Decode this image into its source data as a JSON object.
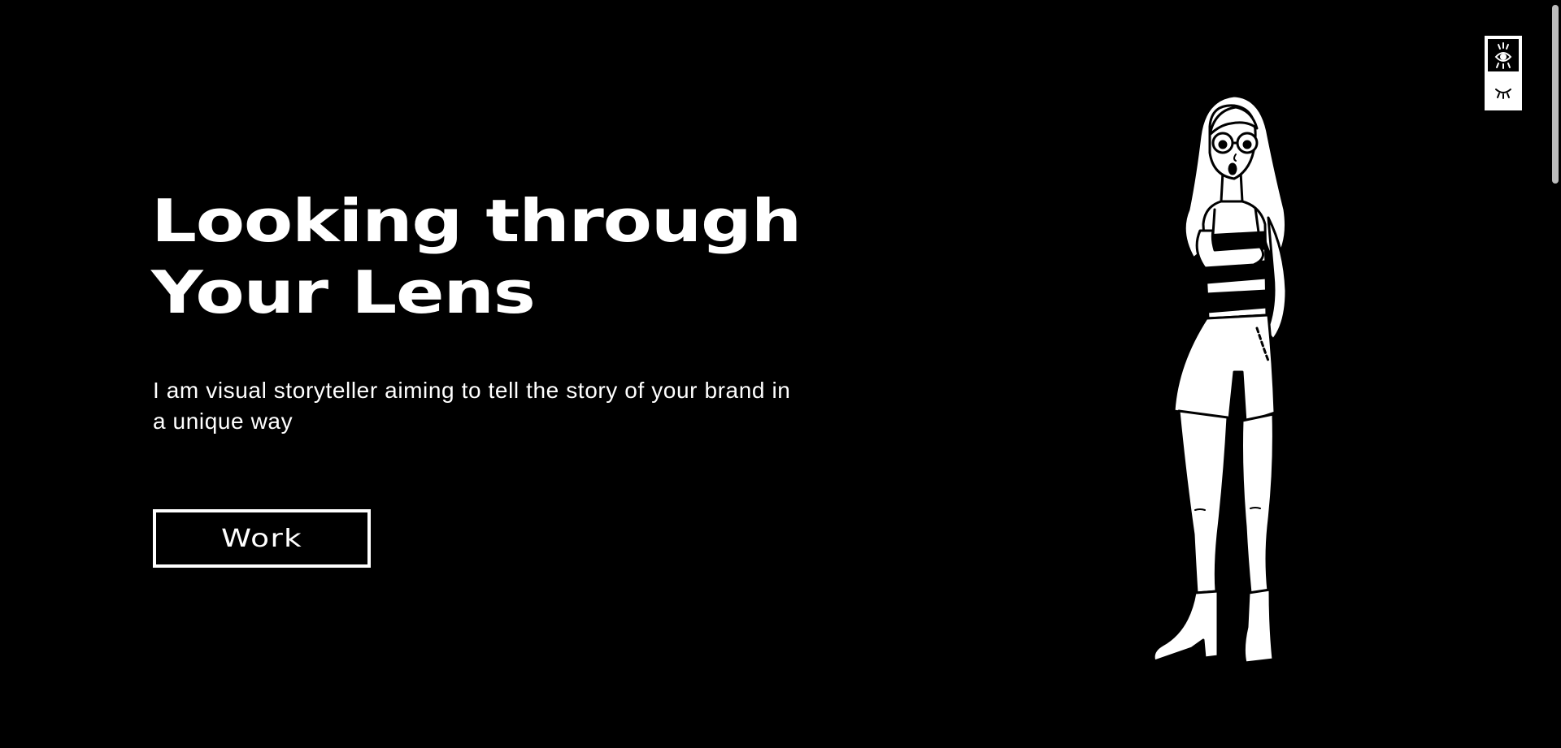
{
  "hero": {
    "title_line_1": "Looking through",
    "title_line_2": "Your Lens",
    "subtitle": "I am visual storyteller aiming to tell the story of your brand in a unique way",
    "button_label": "Work"
  },
  "theme_toggle": {
    "dark_icon": "open-eye-icon",
    "light_icon": "closed-eye-icon"
  },
  "illustration": {
    "icon": "woman-with-glasses-illustration"
  },
  "colors": {
    "background": "#000000",
    "foreground": "#ffffff"
  }
}
